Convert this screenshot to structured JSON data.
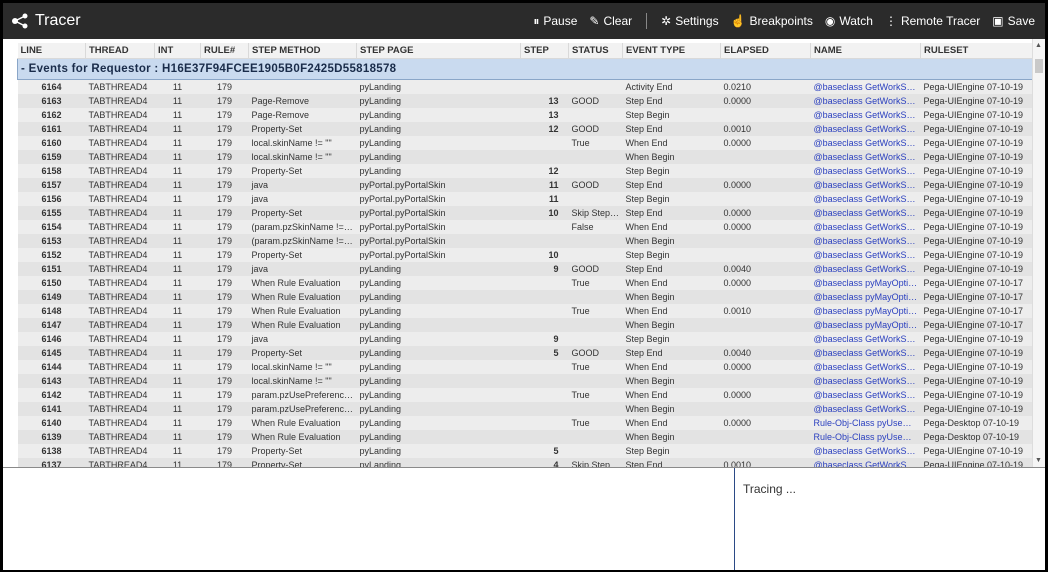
{
  "app": {
    "title": "Tracer"
  },
  "toolbar": {
    "pause_label": "Pause",
    "clear_label": "Clear",
    "settings_label": "Settings",
    "breakpoints_label": "Breakpoints",
    "watch_label": "Watch",
    "remote_tracer_label": "Remote Tracer",
    "save_label": "Save"
  },
  "table": {
    "columns": [
      "LINE",
      "THREAD",
      "INT",
      "RULE#",
      "STEP METHOD",
      "STEP PAGE",
      "STEP",
      "STATUS",
      "EVENT TYPE",
      "ELAPSED",
      "NAME",
      "RULESET"
    ],
    "group_header": "- Events for Requestor : H16E37F94FCEE1905B0F2425D55818578",
    "rows": [
      {
        "line": "6164",
        "thread": "TABTHREAD4",
        "int": "11",
        "rule": "179",
        "method": "",
        "page": "pyLanding",
        "step": "",
        "status": "",
        "event": "Activity End",
        "elapsed": "0.0210",
        "name": "@baseclass GetWorkSty...",
        "ruleset": "Pega-UIEngine 07-10-19"
      },
      {
        "line": "6163",
        "thread": "TABTHREAD4",
        "int": "11",
        "rule": "179",
        "method": "Page-Remove",
        "page": "pyLanding",
        "step": "13",
        "status": "GOOD",
        "event": "Step End",
        "elapsed": "0.0000",
        "name": "@baseclass GetWorkSty...",
        "ruleset": "Pega-UIEngine 07-10-19"
      },
      {
        "line": "6162",
        "thread": "TABTHREAD4",
        "int": "11",
        "rule": "179",
        "method": "Page-Remove",
        "page": "pyLanding",
        "step": "13",
        "status": "",
        "event": "Step Begin",
        "elapsed": "",
        "name": "@baseclass GetWorkSty...",
        "ruleset": "Pega-UIEngine 07-10-19"
      },
      {
        "line": "6161",
        "thread": "TABTHREAD4",
        "int": "11",
        "rule": "179",
        "method": "Property-Set",
        "page": "pyLanding",
        "step": "12",
        "status": "GOOD",
        "event": "Step End",
        "elapsed": "0.0010",
        "name": "@baseclass GetWorkSty...",
        "ruleset": "Pega-UIEngine 07-10-19"
      },
      {
        "line": "6160",
        "thread": "TABTHREAD4",
        "int": "11",
        "rule": "179",
        "method": "local.skinName != \"\"",
        "page": "pyLanding",
        "step": "",
        "status": "True",
        "event": "When End",
        "elapsed": "0.0000",
        "name": "@baseclass GetWorkSty...",
        "ruleset": "Pega-UIEngine 07-10-19"
      },
      {
        "line": "6159",
        "thread": "TABTHREAD4",
        "int": "11",
        "rule": "179",
        "method": "local.skinName != \"\"",
        "page": "pyLanding",
        "step": "",
        "status": "",
        "event": "When Begin",
        "elapsed": "",
        "name": "@baseclass GetWorkSty...",
        "ruleset": "Pega-UIEngine 07-10-19"
      },
      {
        "line": "6158",
        "thread": "TABTHREAD4",
        "int": "11",
        "rule": "179",
        "method": "Property-Set",
        "page": "pyLanding",
        "step": "12",
        "status": "",
        "event": "Step Begin",
        "elapsed": "",
        "name": "@baseclass GetWorkSty...",
        "ruleset": "Pega-UIEngine 07-10-19"
      },
      {
        "line": "6157",
        "thread": "TABTHREAD4",
        "int": "11",
        "rule": "179",
        "method": "java",
        "page": "pyPortal.pyPortalSkin",
        "step": "11",
        "status": "GOOD",
        "event": "Step End",
        "elapsed": "0.0000",
        "name": "@baseclass GetWorkSty...",
        "ruleset": "Pega-UIEngine 07-10-19"
      },
      {
        "line": "6156",
        "thread": "TABTHREAD4",
        "int": "11",
        "rule": "179",
        "method": "java",
        "page": "pyPortal.pyPortalSkin",
        "step": "11",
        "status": "",
        "event": "Step Begin",
        "elapsed": "",
        "name": "@baseclass GetWorkSty...",
        "ruleset": "Pega-UIEngine 07-10-19"
      },
      {
        "line": "6155",
        "thread": "TABTHREAD4",
        "int": "11",
        "rule": "179",
        "method": "Property-Set",
        "page": "pyPortal.pyPortalSkin",
        "step": "10",
        "status": "Skip Step /...",
        "event": "Step End",
        "elapsed": "0.0000",
        "name": "@baseclass GetWorkSty...",
        "ruleset": "Pega-UIEngine 07-10-19"
      },
      {
        "line": "6154",
        "thread": "TABTHREAD4",
        "int": "11",
        "rule": "179",
        "method": "(param.pzSkinName != ...",
        "page": "pyPortal.pyPortalSkin",
        "step": "",
        "status": "False",
        "event": "When End",
        "elapsed": "0.0000",
        "name": "@baseclass GetWorkSty...",
        "ruleset": "Pega-UIEngine 07-10-19"
      },
      {
        "line": "6153",
        "thread": "TABTHREAD4",
        "int": "11",
        "rule": "179",
        "method": "(param.pzSkinName != ...",
        "page": "pyPortal.pyPortalSkin",
        "step": "",
        "status": "",
        "event": "When Begin",
        "elapsed": "",
        "name": "@baseclass GetWorkSty...",
        "ruleset": "Pega-UIEngine 07-10-19"
      },
      {
        "line": "6152",
        "thread": "TABTHREAD4",
        "int": "11",
        "rule": "179",
        "method": "Property-Set",
        "page": "pyPortal.pyPortalSkin",
        "step": "10",
        "status": "",
        "event": "Step Begin",
        "elapsed": "",
        "name": "@baseclass GetWorkSty...",
        "ruleset": "Pega-UIEngine 07-10-19"
      },
      {
        "line": "6151",
        "thread": "TABTHREAD4",
        "int": "11",
        "rule": "179",
        "method": "java",
        "page": "pyLanding",
        "step": "9",
        "status": "GOOD",
        "event": "Step End",
        "elapsed": "0.0040",
        "name": "@baseclass GetWorkSty...",
        "ruleset": "Pega-UIEngine 07-10-19"
      },
      {
        "line": "6150",
        "thread": "TABTHREAD4",
        "int": "11",
        "rule": "179",
        "method": "When Rule Evaluation",
        "page": "pyLanding",
        "step": "",
        "status": "True",
        "event": "When End",
        "elapsed": "0.0000",
        "name": "@baseclass pyMayOptim...",
        "ruleset": "Pega-UIEngine 07-10-17"
      },
      {
        "line": "6149",
        "thread": "TABTHREAD4",
        "int": "11",
        "rule": "179",
        "method": "When Rule Evaluation",
        "page": "pyLanding",
        "step": "",
        "status": "",
        "event": "When Begin",
        "elapsed": "",
        "name": "@baseclass pyMayOptim...",
        "ruleset": "Pega-UIEngine 07-10-17"
      },
      {
        "line": "6148",
        "thread": "TABTHREAD4",
        "int": "11",
        "rule": "179",
        "method": "When Rule Evaluation",
        "page": "pyLanding",
        "step": "",
        "status": "True",
        "event": "When End",
        "elapsed": "0.0010",
        "name": "@baseclass pyMayOptim...",
        "ruleset": "Pega-UIEngine 07-10-17"
      },
      {
        "line": "6147",
        "thread": "TABTHREAD4",
        "int": "11",
        "rule": "179",
        "method": "When Rule Evaluation",
        "page": "pyLanding",
        "step": "",
        "status": "",
        "event": "When Begin",
        "elapsed": "",
        "name": "@baseclass pyMayOptim...",
        "ruleset": "Pega-UIEngine 07-10-17"
      },
      {
        "line": "6146",
        "thread": "TABTHREAD4",
        "int": "11",
        "rule": "179",
        "method": "java",
        "page": "pyLanding",
        "step": "9",
        "status": "",
        "event": "Step Begin",
        "elapsed": "",
        "name": "@baseclass GetWorkSty...",
        "ruleset": "Pega-UIEngine 07-10-19"
      },
      {
        "line": "6145",
        "thread": "TABTHREAD4",
        "int": "11",
        "rule": "179",
        "method": "Property-Set",
        "page": "pyLanding",
        "step": "5",
        "status": "GOOD",
        "event": "Step End",
        "elapsed": "0.0040",
        "name": "@baseclass GetWorkSty...",
        "ruleset": "Pega-UIEngine 07-10-19"
      },
      {
        "line": "6144",
        "thread": "TABTHREAD4",
        "int": "11",
        "rule": "179",
        "method": "local.skinName != \"\"",
        "page": "pyLanding",
        "step": "",
        "status": "True",
        "event": "When End",
        "elapsed": "0.0000",
        "name": "@baseclass GetWorkSty...",
        "ruleset": "Pega-UIEngine 07-10-19"
      },
      {
        "line": "6143",
        "thread": "TABTHREAD4",
        "int": "11",
        "rule": "179",
        "method": "local.skinName != \"\"",
        "page": "pyLanding",
        "step": "",
        "status": "",
        "event": "When Begin",
        "elapsed": "",
        "name": "@baseclass GetWorkSty...",
        "ruleset": "Pega-UIEngine 07-10-19"
      },
      {
        "line": "6142",
        "thread": "TABTHREAD4",
        "int": "11",
        "rule": "179",
        "method": "param.pzUsePreference...",
        "page": "pyLanding",
        "step": "",
        "status": "True",
        "event": "When End",
        "elapsed": "0.0000",
        "name": "@baseclass GetWorkSty...",
        "ruleset": "Pega-UIEngine 07-10-19"
      },
      {
        "line": "6141",
        "thread": "TABTHREAD4",
        "int": "11",
        "rule": "179",
        "method": "param.pzUsePreference...",
        "page": "pyLanding",
        "step": "",
        "status": "",
        "event": "When Begin",
        "elapsed": "",
        "name": "@baseclass GetWorkSty...",
        "ruleset": "Pega-UIEngine 07-10-19"
      },
      {
        "line": "6140",
        "thread": "TABTHREAD4",
        "int": "11",
        "rule": "179",
        "method": "When Rule Evaluation",
        "page": "pyLanding",
        "step": "",
        "status": "True",
        "event": "When End",
        "elapsed": "0.0000",
        "name": "Rule-Obj-Class pyUseDe...",
        "ruleset": "Pega-Desktop 07-10-19"
      },
      {
        "line": "6139",
        "thread": "TABTHREAD4",
        "int": "11",
        "rule": "179",
        "method": "When Rule Evaluation",
        "page": "pyLanding",
        "step": "",
        "status": "",
        "event": "When Begin",
        "elapsed": "",
        "name": "Rule-Obj-Class pyUseDe...",
        "ruleset": "Pega-Desktop 07-10-19"
      },
      {
        "line": "6138",
        "thread": "TABTHREAD4",
        "int": "11",
        "rule": "179",
        "method": "Property-Set",
        "page": "pyLanding",
        "step": "5",
        "status": "",
        "event": "Step Begin",
        "elapsed": "",
        "name": "@baseclass GetWorkSty...",
        "ruleset": "Pega-UIEngine 07-10-19"
      },
      {
        "line": "6137",
        "thread": "TABTHREAD4",
        "int": "11",
        "rule": "179",
        "method": "Property-Set",
        "page": "pyLanding",
        "step": "4",
        "status": "Skip Step /...",
        "event": "Step End",
        "elapsed": "0.0010",
        "name": "@baseclass GetWorkSty...",
        "ruleset": "Pega-UIEngine 07-10-19"
      }
    ]
  },
  "status_panel": {
    "text": "Tracing ..."
  },
  "colors": {
    "topbar": "#2b2b2b",
    "group_header_bg": "#c9daef",
    "name_link": "#2a3fbf"
  }
}
